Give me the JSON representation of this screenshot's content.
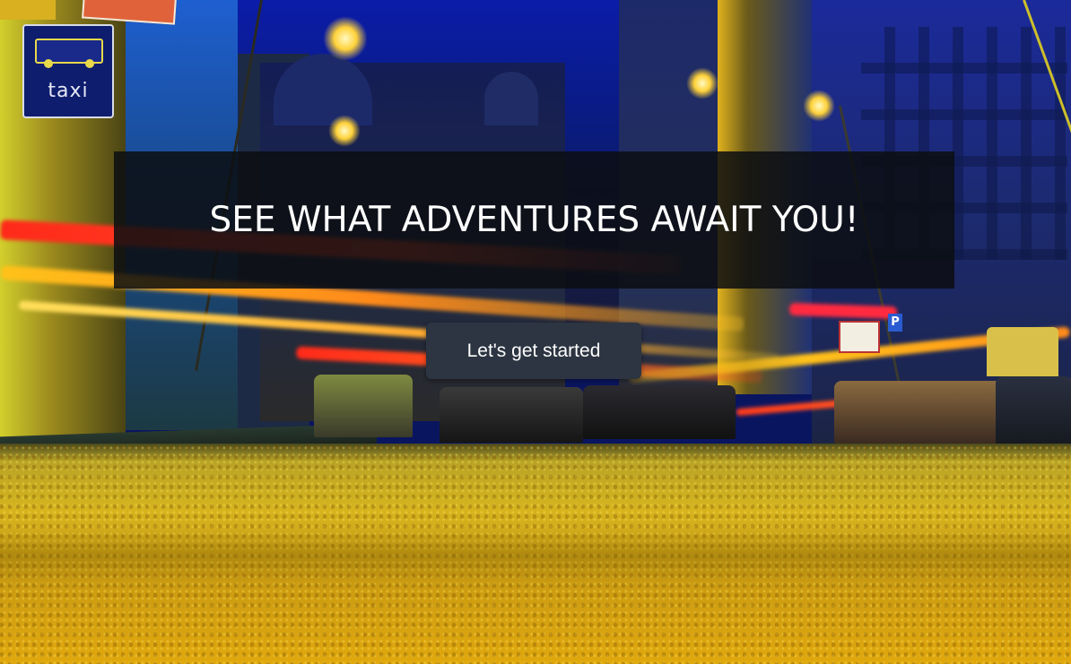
{
  "hero": {
    "title": "SEE WHAT ADVENTURES AWAIT YOU!",
    "cta_label": "Let's get started"
  },
  "background": {
    "taxi_sign_label": "taxi",
    "parking_sign_label": "P"
  },
  "colors": {
    "band_background": "#0c0e12",
    "button_background": "#2c3541",
    "text": "#ffffff"
  }
}
